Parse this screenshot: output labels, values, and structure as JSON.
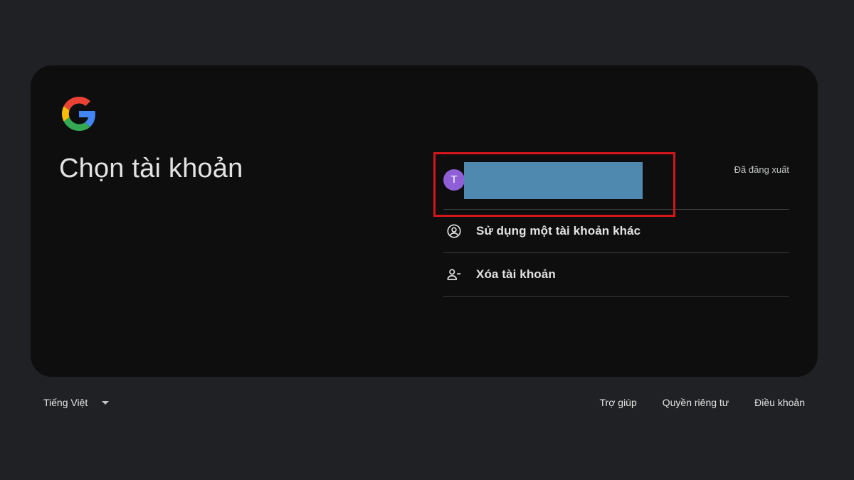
{
  "card": {
    "logo": {
      "icon": "google-g-icon",
      "colors": [
        "#4285f4",
        "#ea4335",
        "#fbbc05",
        "#34a853"
      ]
    },
    "title": "Chọn tài khoản"
  },
  "accounts": [
    {
      "avatar_letter": "T",
      "avatar_color": "#8e5fd6",
      "status": "Đã đăng xuất"
    }
  ],
  "options": [
    {
      "icon": "account-circle-icon",
      "label": "Sử dụng một tài khoản khác"
    },
    {
      "icon": "remove-account-icon",
      "label": "Xóa tài khoản"
    }
  ],
  "footer": {
    "language": "Tiếng Việt",
    "links": [
      "Trợ giúp",
      "Quyền riêng tư",
      "Điều khoản"
    ]
  },
  "colors": {
    "background": "#202124",
    "card": "#0e0e0f",
    "highlight": "#d3161b",
    "redaction": "#4f89b0"
  }
}
